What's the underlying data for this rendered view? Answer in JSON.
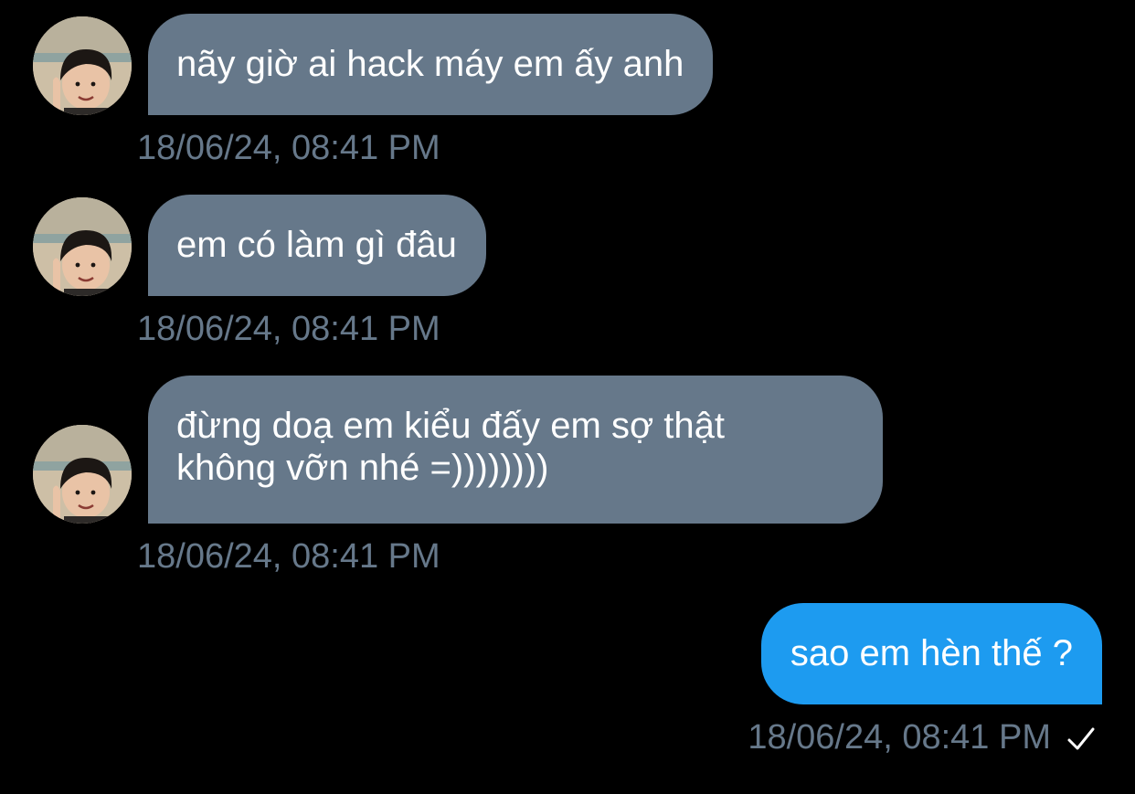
{
  "messages": [
    {
      "direction": "incoming",
      "text_lines": [
        "nãy giờ ai hack máy em ấy anh"
      ],
      "timestamp": "18/06/24, 08:41 PM"
    },
    {
      "direction": "incoming",
      "text_lines": [
        "em có làm gì đâu"
      ],
      "timestamp": "18/06/24, 08:41 PM"
    },
    {
      "direction": "incoming",
      "text_lines": [
        "đừng doạ em kiểu đấy em sợ thật",
        "không vỡn nhé =))))))))"
      ],
      "timestamp": "18/06/24, 08:41 PM"
    },
    {
      "direction": "outgoing",
      "text_lines": [
        "sao em hèn thế ?"
      ],
      "timestamp": "18/06/24, 08:41 PM",
      "status_icon": "check-icon"
    }
  ],
  "colors": {
    "background": "#000000",
    "incoming_bubble": "#66788a",
    "outgoing_bubble": "#1d9bf0",
    "timestamp": "#66788a",
    "text": "#ffffff"
  }
}
